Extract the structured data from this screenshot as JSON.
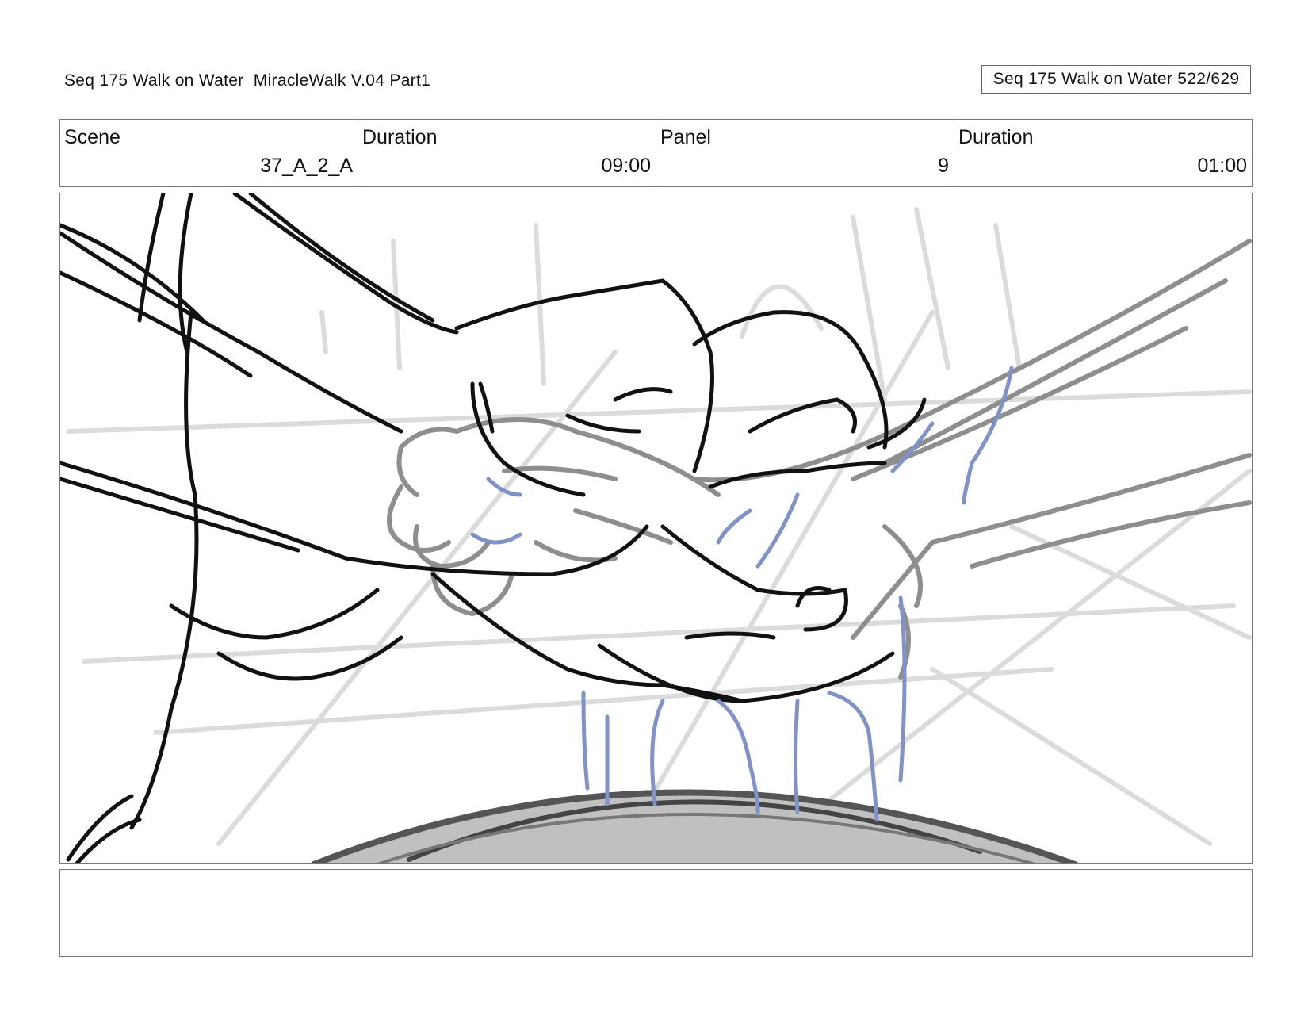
{
  "header": {
    "title": "Seq 175 Walk on Water  MiracleWalk V.04 Part1",
    "page_counter": "Seq 175 Walk on Water 522/629"
  },
  "info": {
    "scene_label": "Scene",
    "scene_value": "37_A_2_A",
    "duration_label": "Duration",
    "duration_value": "09:00",
    "panel_label": "Panel",
    "panel_value": "9",
    "panel_duration_label": "Duration",
    "panel_duration_value": "01:00"
  },
  "notes": {
    "text": ""
  },
  "colors": {
    "ink": "#111111",
    "sketch_gray": "#8a8a8a",
    "water_blue": "#7f93c9",
    "bowl_gray": "#bcbcbc"
  }
}
